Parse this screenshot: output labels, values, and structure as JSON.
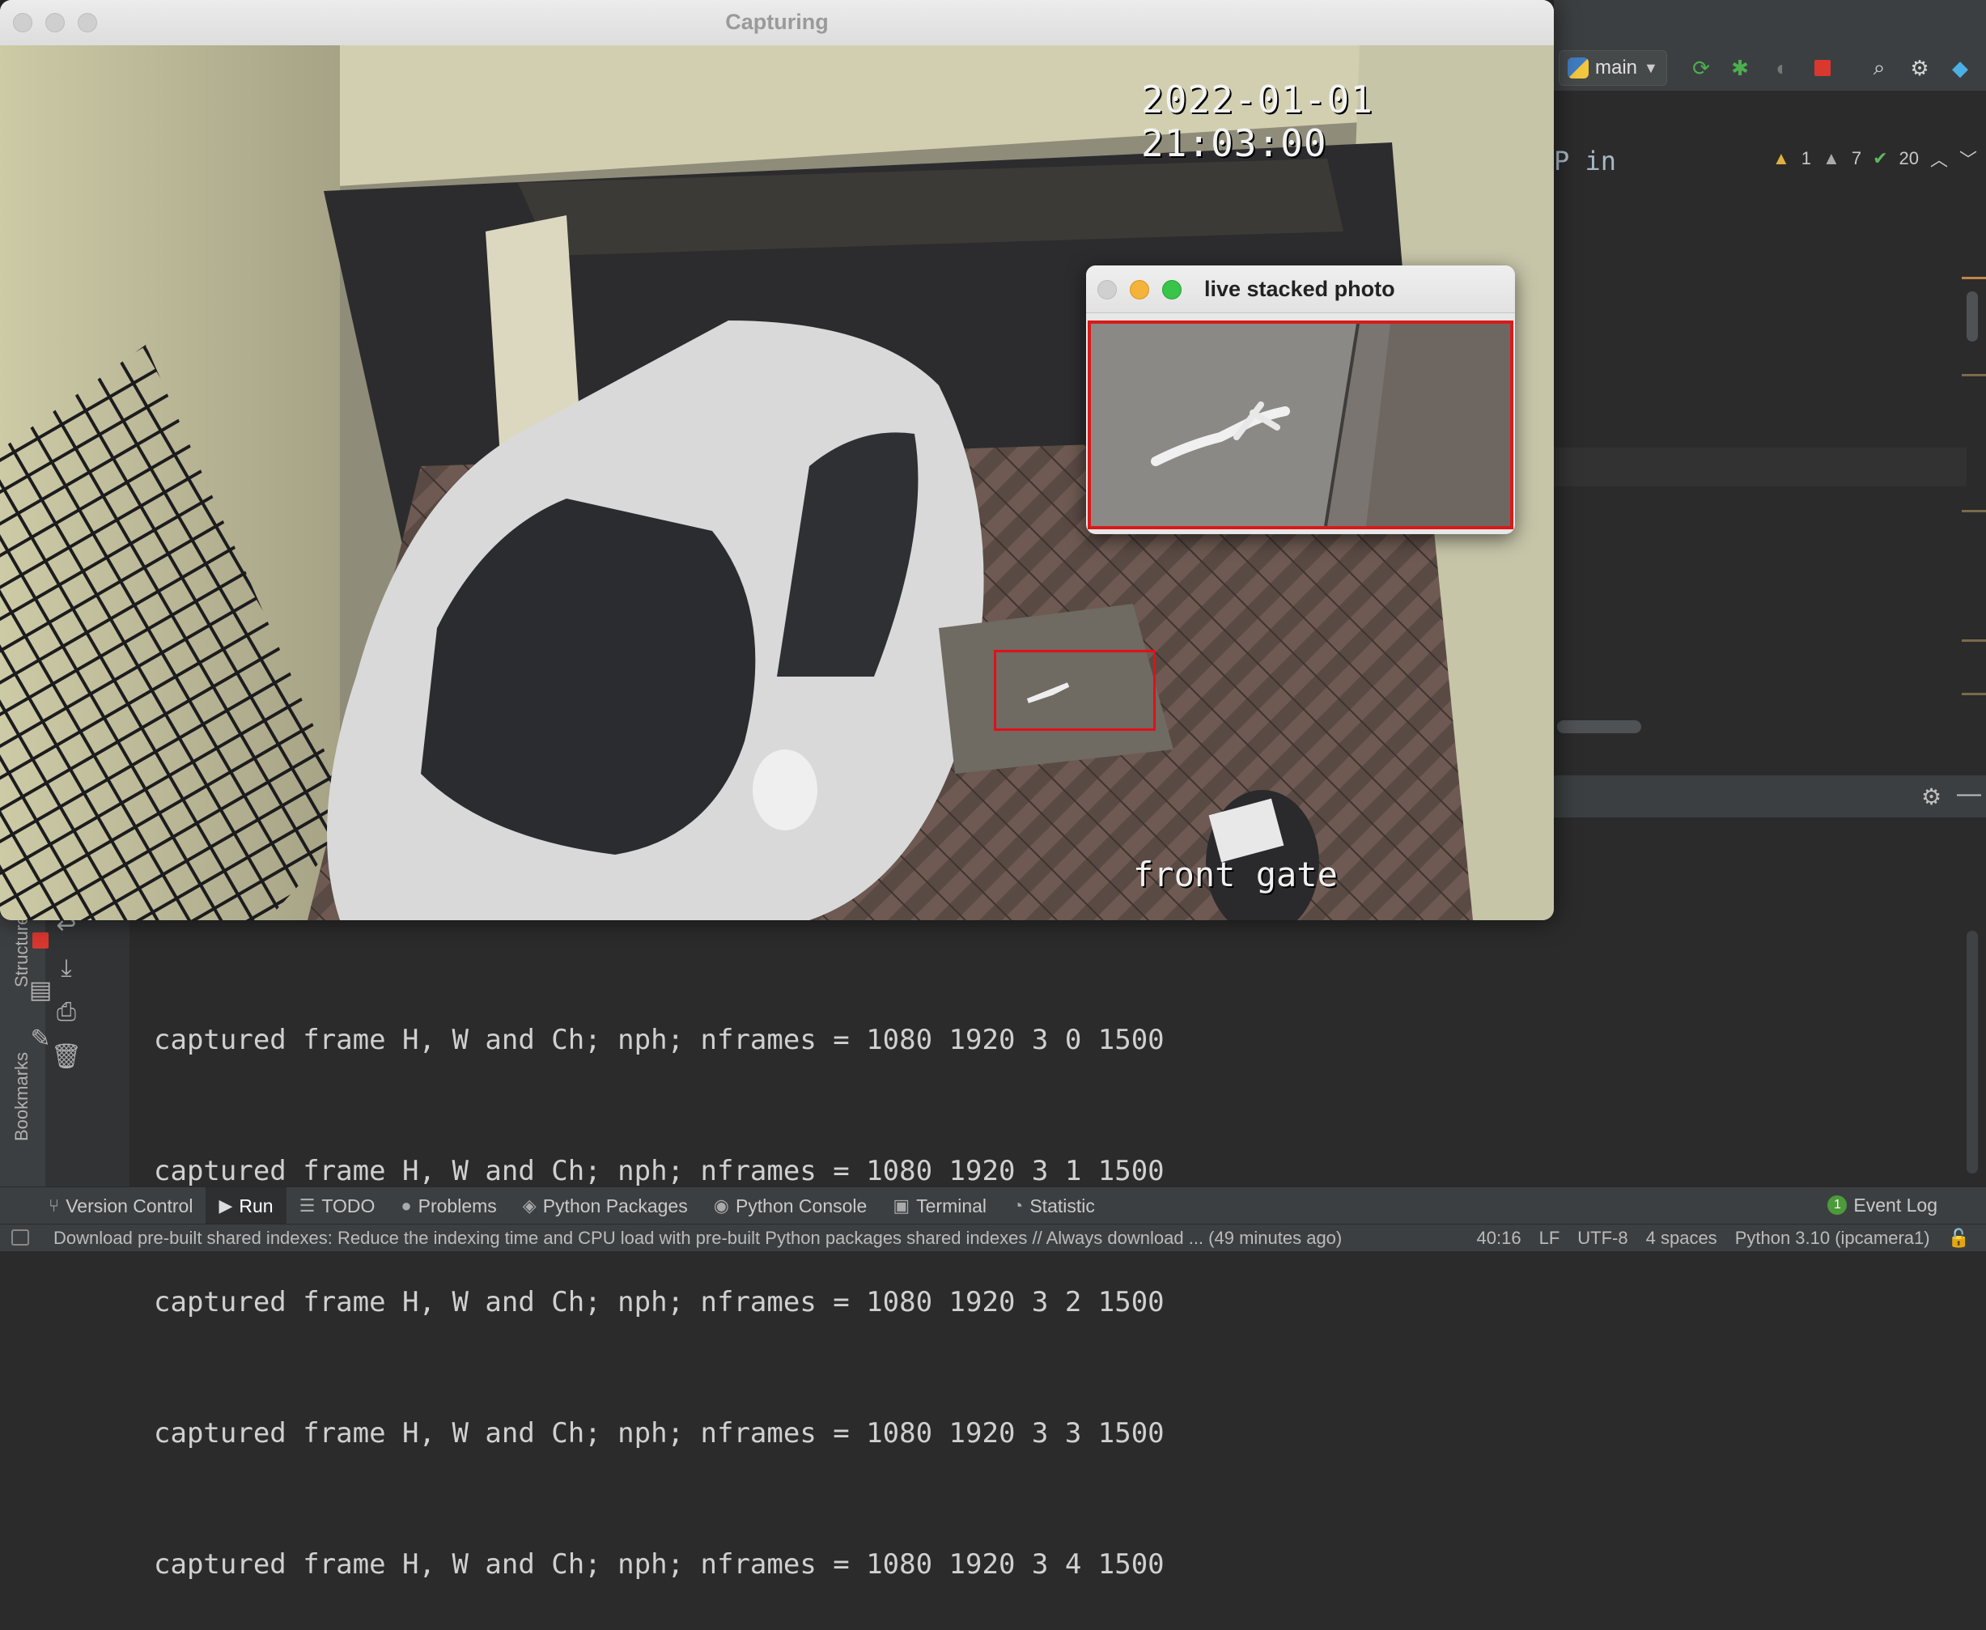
{
  "ide": {
    "branch": "main",
    "editor_fragment": "P in",
    "inspections": {
      "warnings_a": "1",
      "warnings_b": "7",
      "ok": "20"
    },
    "console": {
      "lines": [
        "captured frame H, W and Ch; nph; nframes = 1080 1920 3 0 1500",
        "captured frame H, W and Ch; nph; nframes = 1080 1920 3 1 1500",
        "captured frame H, W and Ch; nph; nframes = 1080 1920 3 2 1500",
        "captured frame H, W and Ch; nph; nframes = 1080 1920 3 3 1500",
        "captured frame H, W and Ch; nph; nframes = 1080 1920 3 4 1500"
      ]
    },
    "side_labels": {
      "structure": "Structure",
      "bookmarks": "Bookmarks"
    },
    "bottom_tabs": [
      {
        "label": "Version Control",
        "icon": "branch-icon"
      },
      {
        "label": "Run",
        "icon": "play-icon"
      },
      {
        "label": "TODO",
        "icon": "list-icon"
      },
      {
        "label": "Problems",
        "icon": "info-icon"
      },
      {
        "label": "Python Packages",
        "icon": "layers-icon"
      },
      {
        "label": "Python Console",
        "icon": "python-icon"
      },
      {
        "label": "Terminal",
        "icon": "terminal-icon"
      },
      {
        "label": "Statistic",
        "icon": "statistic-icon"
      }
    ],
    "event_log": {
      "count": "1",
      "label": "Event Log"
    },
    "status": {
      "message": "Download pre-built shared indexes: Reduce the indexing time and CPU load with pre-built Python packages shared indexes // Always download ... (49 minutes ago)",
      "position": "40:16",
      "line_sep": "LF",
      "encoding": "UTF-8",
      "indent": "4 spaces",
      "interpreter": "Python 3.10 (ipcamera1)"
    }
  },
  "capture_window": {
    "title": "Capturing",
    "timestamp": "2022-01-01 21:03:00",
    "camera_label": "front gate"
  },
  "live_window": {
    "title": "live stacked photo"
  },
  "colors": {
    "detection_box": "#e0101a",
    "run_stop": "#d9382f",
    "rerun": "#4caf50"
  }
}
